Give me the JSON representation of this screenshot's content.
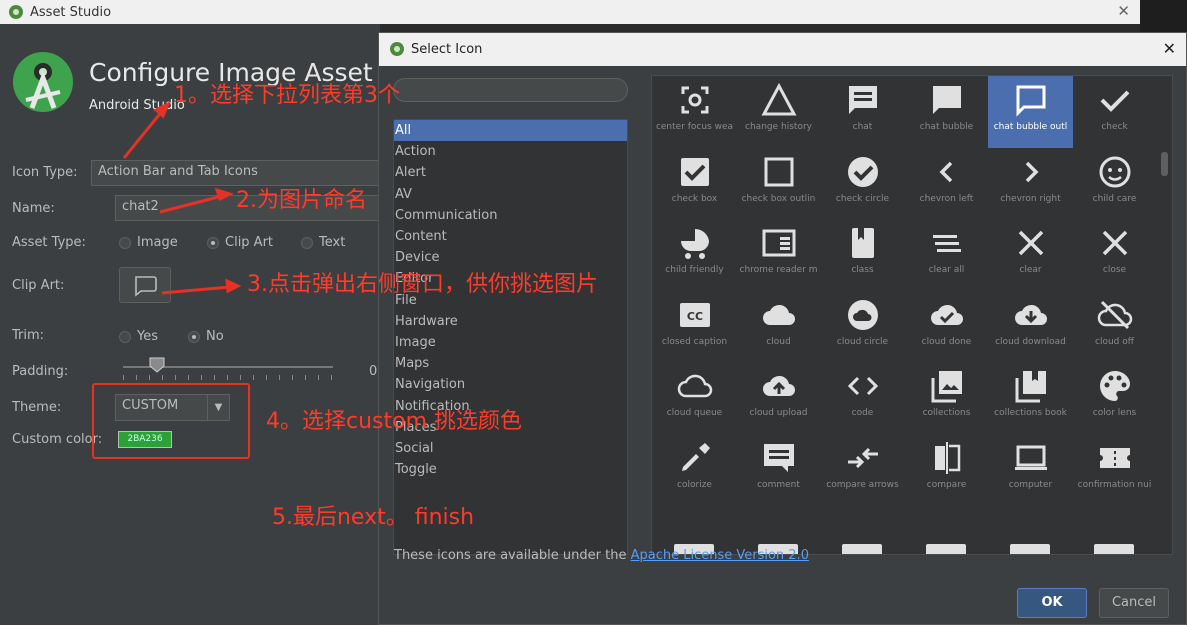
{
  "window": {
    "title": "Asset Studio",
    "close": "✕"
  },
  "header": {
    "title": "Configure Image Asset",
    "subtitle": "Android Studio"
  },
  "form": {
    "icon_type_label": "Icon Type:",
    "icon_type_value": "Action Bar and Tab Icons",
    "name_label": "Name:",
    "name_value": "chat2",
    "asset_type_label": "Asset Type:",
    "asset_type_options": [
      "Image",
      "Clip Art",
      "Text"
    ],
    "asset_type_selected": "Clip Art",
    "clip_art_label": "Clip Art:",
    "trim_label": "Trim:",
    "trim_options": [
      "Yes",
      "No"
    ],
    "trim_selected": "No",
    "padding_label": "Padding:",
    "padding_value": "0",
    "theme_label": "Theme:",
    "theme_value": "CUSTOM",
    "custom_color_label": "Custom color:",
    "custom_color_value": "2BA236"
  },
  "dialog": {
    "title": "Select Icon",
    "close": "✕",
    "categories": [
      "All",
      "Action",
      "Alert",
      "AV",
      "Communication",
      "Content",
      "Device",
      "Editor",
      "File",
      "Hardware",
      "Image",
      "Maps",
      "Navigation",
      "Notification",
      "Places",
      "Social",
      "Toggle"
    ],
    "selected_category": "All",
    "icons": [
      {
        "label": "center focus wea",
        "icon": "center-focus-weak"
      },
      {
        "label": "change history",
        "icon": "change-history"
      },
      {
        "label": "chat",
        "icon": "chat"
      },
      {
        "label": "chat bubble",
        "icon": "chat-bubble"
      },
      {
        "label": "chat bubble outl",
        "icon": "chat-bubble-outline",
        "selected": true
      },
      {
        "label": "check",
        "icon": "check"
      },
      {
        "label": "check box",
        "icon": "check-box"
      },
      {
        "label": "check box outlin",
        "icon": "check-box-outline"
      },
      {
        "label": "check circle",
        "icon": "check-circle"
      },
      {
        "label": "chevron left",
        "icon": "chevron-left"
      },
      {
        "label": "chevron right",
        "icon": "chevron-right"
      },
      {
        "label": "child care",
        "icon": "child-care"
      },
      {
        "label": "child friendly",
        "icon": "child-friendly"
      },
      {
        "label": "chrome reader m",
        "icon": "chrome-reader-mode"
      },
      {
        "label": "class",
        "icon": "class"
      },
      {
        "label": "clear all",
        "icon": "clear-all"
      },
      {
        "label": "clear",
        "icon": "clear"
      },
      {
        "label": "close",
        "icon": "close"
      },
      {
        "label": "closed caption",
        "icon": "closed-caption"
      },
      {
        "label": "cloud",
        "icon": "cloud"
      },
      {
        "label": "cloud circle",
        "icon": "cloud-circle"
      },
      {
        "label": "cloud done",
        "icon": "cloud-done"
      },
      {
        "label": "cloud download",
        "icon": "cloud-download"
      },
      {
        "label": "cloud off",
        "icon": "cloud-off"
      },
      {
        "label": "cloud queue",
        "icon": "cloud-queue"
      },
      {
        "label": "cloud upload",
        "icon": "cloud-upload"
      },
      {
        "label": "code",
        "icon": "code"
      },
      {
        "label": "collections",
        "icon": "collections"
      },
      {
        "label": "collections book",
        "icon": "collections-bookmark"
      },
      {
        "label": "color lens",
        "icon": "color-lens"
      },
      {
        "label": "colorize",
        "icon": "colorize"
      },
      {
        "label": "comment",
        "icon": "comment"
      },
      {
        "label": "compare arrows",
        "icon": "compare-arrows"
      },
      {
        "label": "compare",
        "icon": "compare"
      },
      {
        "label": "computer",
        "icon": "computer"
      },
      {
        "label": "confirmation nui",
        "icon": "confirmation-number"
      }
    ],
    "license_text": "These icons are available under the ",
    "license_link": "Apache License Version 2.0",
    "ok": "OK",
    "cancel": "Cancel"
  },
  "annotations": {
    "a1": "1。选择下拉列表第3个",
    "a2": "2.为图片命名",
    "a3": "3.点击弹出右侧窗口，供你挑选图片",
    "a4": "4。选择custom 挑选颜色",
    "a5": "5.最后next。 finish"
  },
  "colors": {
    "accent": "#4b6eaf",
    "annotation": "#ff3b2a",
    "custom_color": "#2BA236"
  }
}
